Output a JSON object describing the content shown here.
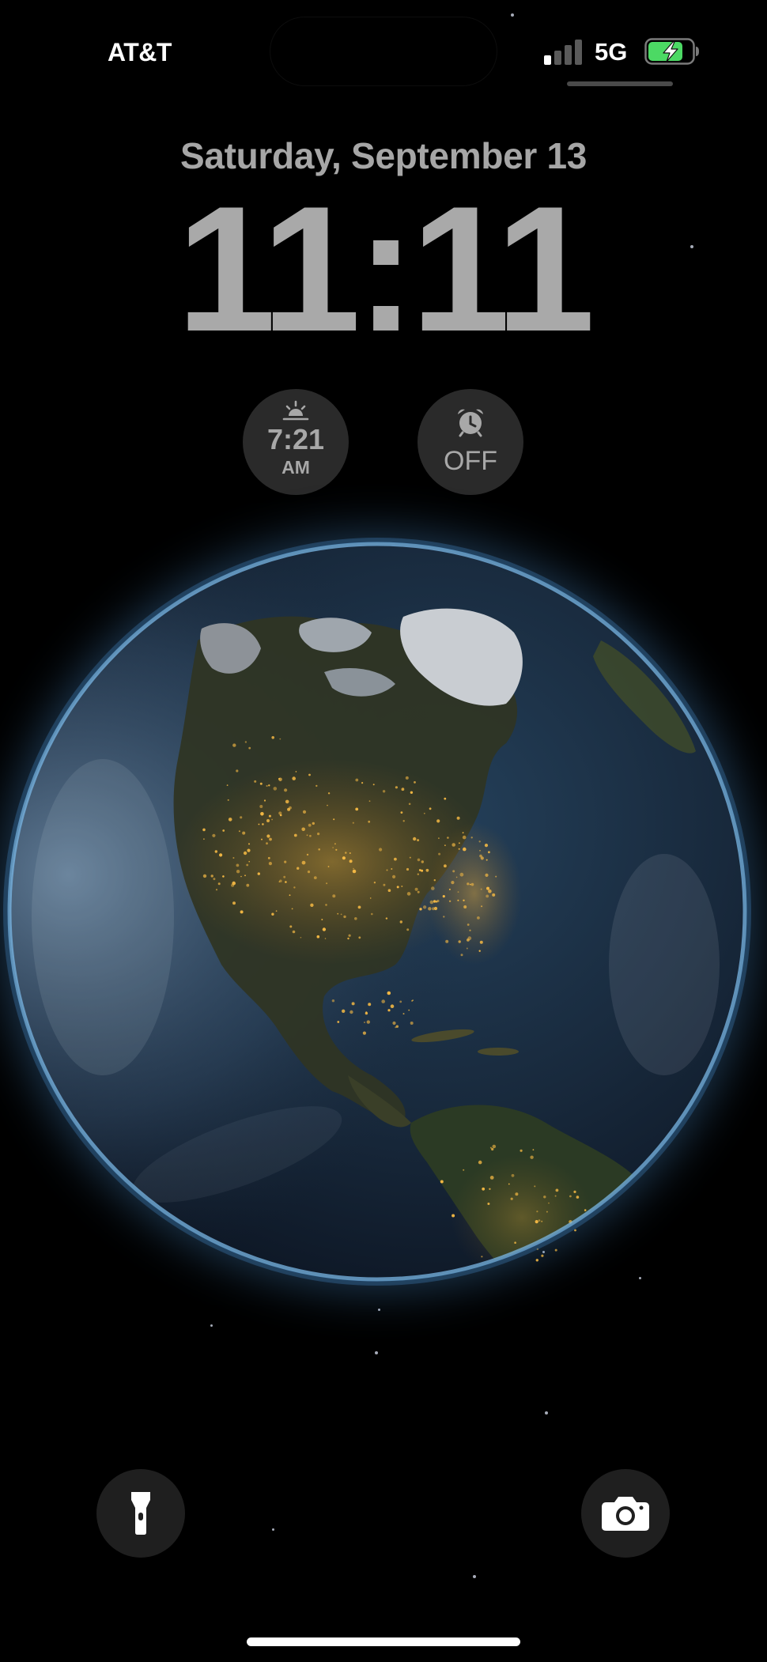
{
  "status_bar": {
    "carrier": "AT&T",
    "network_type": "5G",
    "signal_bars_total": 4,
    "signal_bars_active": 1,
    "battery_level": 0.8,
    "battery_charging": true,
    "battery_color": "#4cd964"
  },
  "lock_screen": {
    "date": "Saturday, September 13",
    "time": "11:11",
    "text_color": "#a9a9a9"
  },
  "widgets": {
    "sunrise": {
      "icon": "sunrise-icon",
      "time": "7:21",
      "ampm": "AM"
    },
    "alarm": {
      "icon": "alarm-clock-icon",
      "status": "OFF"
    }
  },
  "wallpaper": {
    "subject": "earth-at-night",
    "glow_color": "#5aa0dc",
    "city_lights_color": "#f2b13a"
  },
  "quick_actions": {
    "flashlight": {
      "icon": "flashlight-icon"
    },
    "camera": {
      "icon": "camera-icon"
    }
  }
}
